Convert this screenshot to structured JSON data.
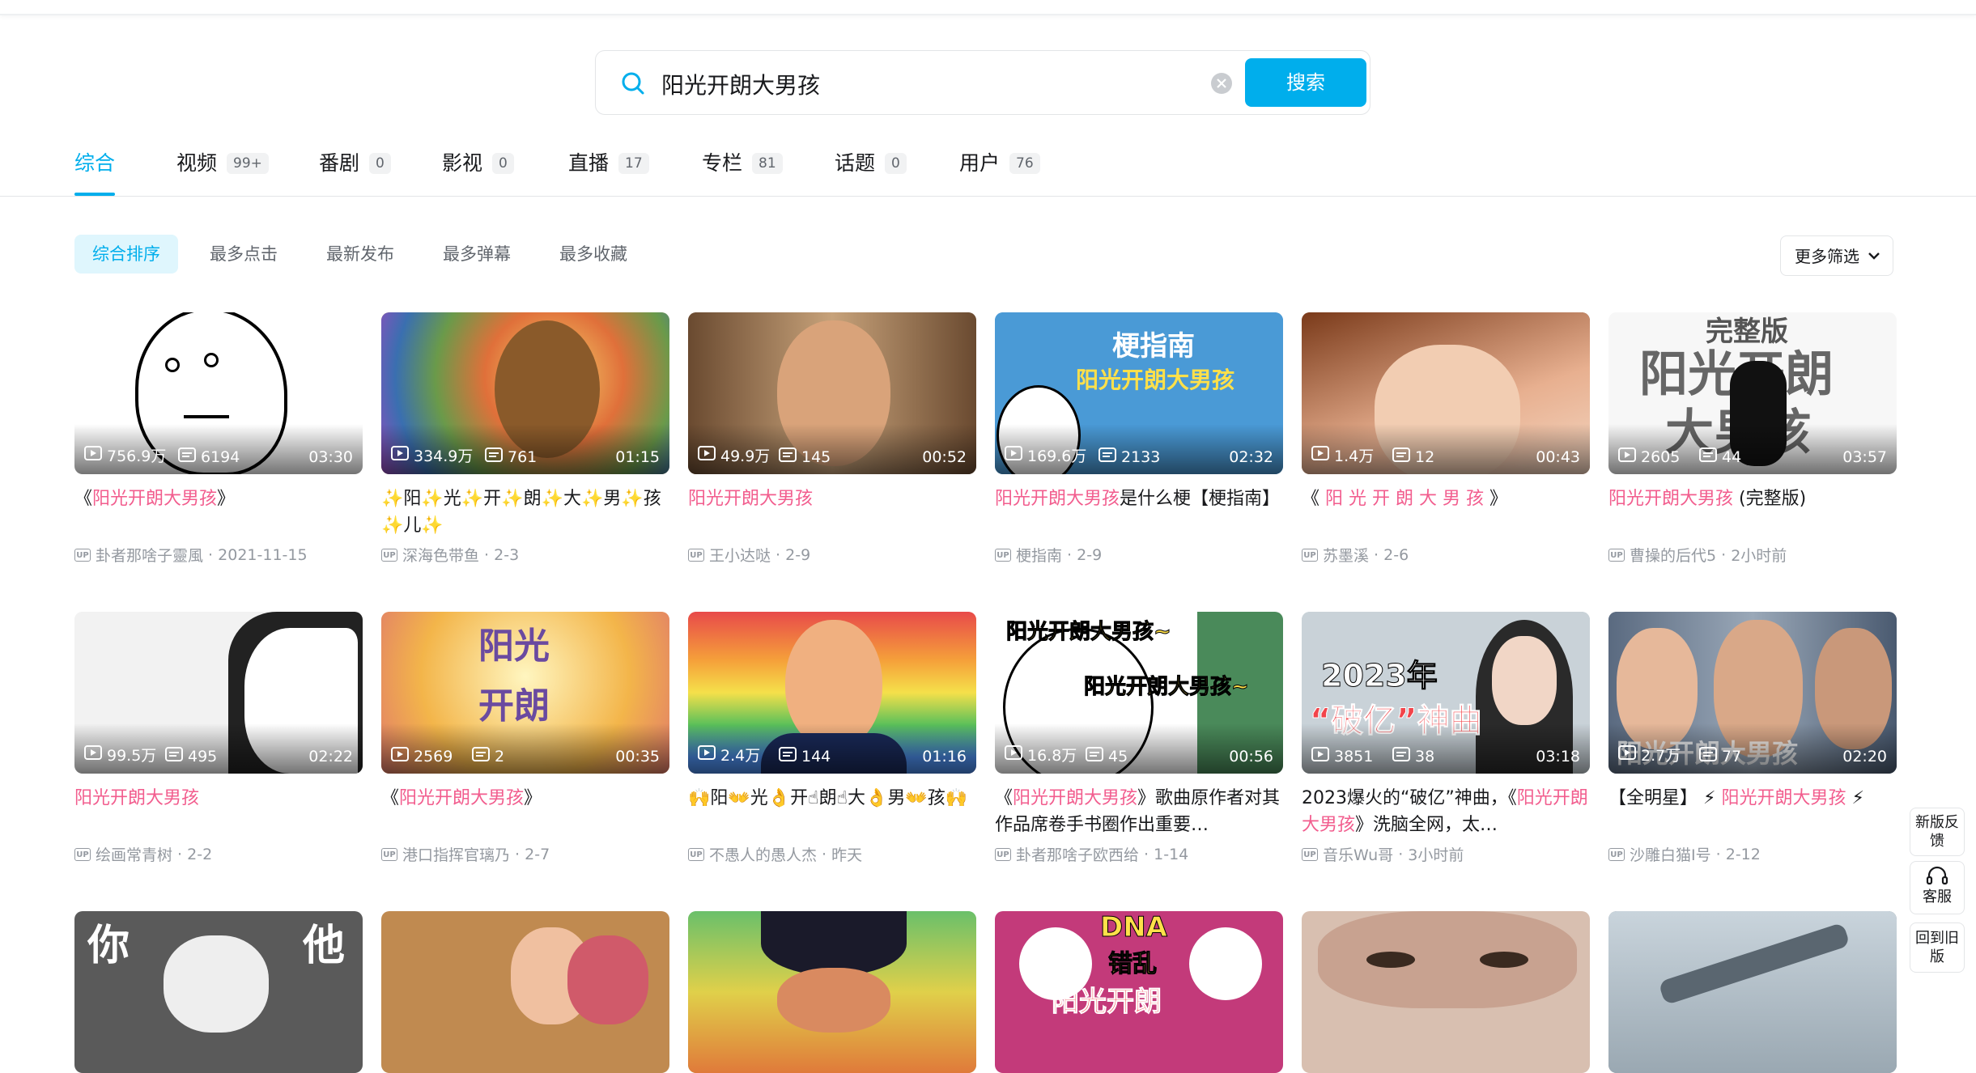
{
  "search": {
    "query": "阳光开朗大男孩",
    "button_label": "搜索"
  },
  "tabs": [
    {
      "label": "综合",
      "count": ""
    },
    {
      "label": "视频",
      "count": "99+"
    },
    {
      "label": "番剧",
      "count": "0"
    },
    {
      "label": "影视",
      "count": "0"
    },
    {
      "label": "直播",
      "count": "17"
    },
    {
      "label": "专栏",
      "count": "81"
    },
    {
      "label": "话题",
      "count": "0"
    },
    {
      "label": "用户",
      "count": "76"
    }
  ],
  "sort_options": [
    "综合排序",
    "最多点击",
    "最新发布",
    "最多弹幕",
    "最多收藏"
  ],
  "more_filter_label": "更多筛选",
  "videos": [
    {
      "views": "756.9万",
      "danmaku": "6194",
      "duration": "03:30",
      "title_pre": "《",
      "title_hl": "阳光开朗大男孩",
      "title_post": "》",
      "author": "卦者那啥子靈風",
      "date": "2021-11-15",
      "thumb_color": "#ffffff"
    },
    {
      "views": "334.9万",
      "danmaku": "761",
      "duration": "01:15",
      "title_pre": "",
      "title_hl": "",
      "title_post": "✨阳✨光✨开✨朗✨大✨男✨孩✨儿✨",
      "author": "深海色带鱼",
      "date": "2-3",
      "thumb_color": "#c79b3c"
    },
    {
      "views": "49.9万",
      "danmaku": "145",
      "duration": "00:52",
      "title_pre": "",
      "title_hl": "阳光开朗大男孩",
      "title_post": "",
      "author": "王小达哒",
      "date": "2-9",
      "thumb_color": "#8a6a4a"
    },
    {
      "views": "169.6万",
      "danmaku": "2133",
      "duration": "02:32",
      "title_pre": "",
      "title_hl": "阳光开朗大男孩",
      "title_post": "是什么梗【梗指南】",
      "author": "梗指南",
      "date": "2-9",
      "thumb_color": "#3f8fcf"
    },
    {
      "views": "1.4万",
      "danmaku": "12",
      "duration": "00:43",
      "title_pre": "《 ",
      "title_hl": "阳 光 开 朗 大 男 孩",
      "title_post": " 》",
      "author": "苏墨溪",
      "date": "2-6",
      "thumb_color": "#9a4a2a"
    },
    {
      "views": "2605",
      "danmaku": "44",
      "duration": "03:57",
      "title_pre": "",
      "title_hl": "阳光开朗大男孩",
      "title_post": " (完整版)",
      "author": "曹操的后代5",
      "date": "2小时前",
      "thumb_color": "#f4f4f4"
    },
    {
      "views": "99.5万",
      "danmaku": "495",
      "duration": "02:22",
      "title_pre": "",
      "title_hl": "阳光开朗大男孩",
      "title_post": "",
      "author": "绘画常青树",
      "date": "2-2",
      "thumb_color": "#e8e8e8"
    },
    {
      "views": "2569",
      "danmaku": "2",
      "duration": "00:35",
      "title_pre": "《",
      "title_hl": "阳光开朗大男孩",
      "title_post": "》",
      "author": "港口指挥官璃乃",
      "date": "2-7",
      "thumb_color": "#f3c26a"
    },
    {
      "views": "2.4万",
      "danmaku": "144",
      "duration": "01:16",
      "title_pre": "",
      "title_hl": "",
      "title_post": "🙌阳👐光👌开☝朗☝大👌男👐孩🙌",
      "author": "不愚人的愚人杰",
      "date": "昨天",
      "thumb_color": "#e86a5a"
    },
    {
      "views": "16.8万",
      "danmaku": "45",
      "duration": "00:56",
      "title_pre": "《",
      "title_hl": "阳光开朗大男孩",
      "title_post": "》歌曲原作者对其作品席卷手书圈作出重要…",
      "author": "卦者那啥子欧西给",
      "date": "1-14",
      "thumb_color": "#ffffff"
    },
    {
      "views": "3851",
      "danmaku": "38",
      "duration": "03:18",
      "title_pre": "2023爆火的“破亿”神曲，《",
      "title_hl": "阳光开朗大男孩",
      "title_post": "》洗脑全网，太…",
      "author": "音乐Wu哥",
      "date": "3小时前",
      "thumb_color": "#b7c4cc"
    },
    {
      "views": "2.7万",
      "danmaku": "77",
      "duration": "02:20",
      "title_pre": "【全明星】 ⚡ ",
      "title_hl": "阳光开朗大男孩",
      "title_post": " ⚡",
      "author": "沙雕白猫I号",
      "date": "2-12",
      "thumb_color": "#6a7e95"
    }
  ],
  "thumb_texts": {
    "t4": "梗指南",
    "t4b": "阳光开朗大男孩",
    "t6a": "完整版",
    "t6b": "阳光开朗",
    "t6c": "大男孩",
    "t8a": "阳光",
    "t8b": "开朗",
    "t10a": "阳光开朗大男孩~",
    "t10b": "阳光开朗大男孩~",
    "t11a": "2023年",
    "t11b": "“破亿”神曲",
    "t12": "阳光开朗大男孩",
    "r3a": "你",
    "r3b": "他",
    "r3c": "DNA",
    "r3d": "错乱",
    "r3e": "阳光开朗"
  },
  "row3_colors": [
    "#5a5a5a",
    "#c08a50",
    "#6ac06a",
    "#c33a7a",
    "#d8bfb0",
    "#7c8a95"
  ],
  "side": {
    "feedback": "新版反馈",
    "service": "客服",
    "old": "回到旧版"
  }
}
